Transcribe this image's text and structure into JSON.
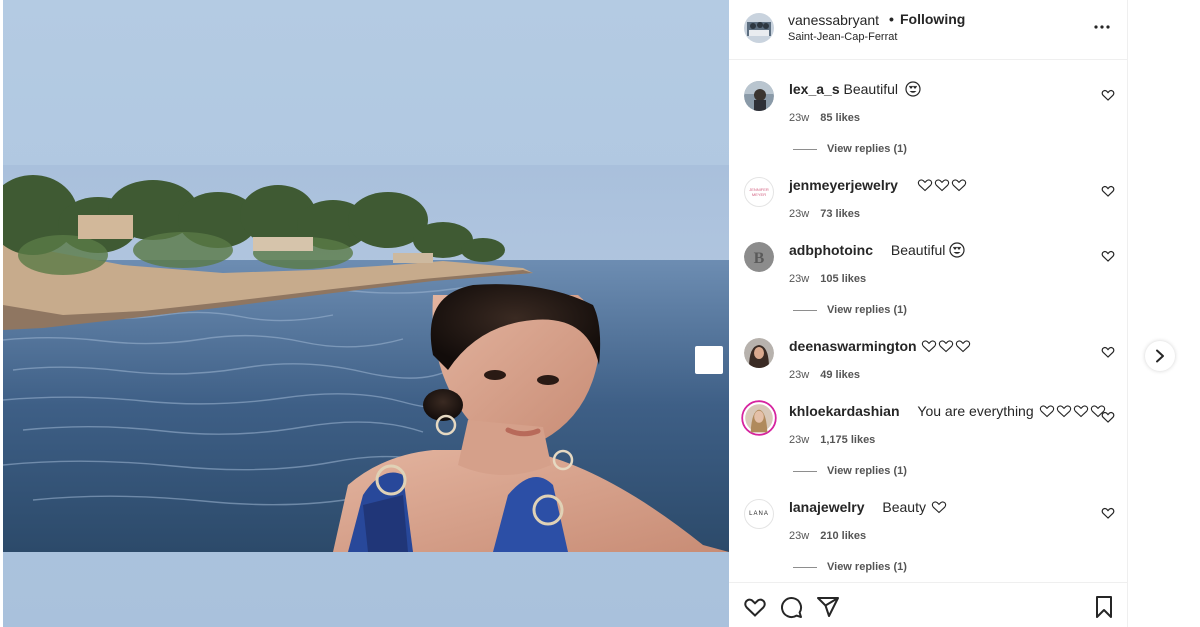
{
  "post": {
    "username": "vanessabryant",
    "follow_label": "Following",
    "location": "Saint-Jean-Cap-Ferrat"
  },
  "comments": [
    {
      "user": "lex_a_s",
      "text": "Beautiful",
      "emoji": "heart-eyes-emoji",
      "age": "23w",
      "likes": "85 likes",
      "replies": "View replies (1)"
    },
    {
      "user": "jenmeyerjewelry",
      "text": "",
      "hearts": 3,
      "age": "23w",
      "likes": "73 likes",
      "avatar_text": "JENNIFER MEYER"
    },
    {
      "user": "adbphotoinc",
      "text": "Beautiful",
      "emoji": "heart-eyes-emoji",
      "age": "23w",
      "likes": "105 likes",
      "replies": "View replies (1)"
    },
    {
      "user": "deenaswarmington",
      "text": "",
      "hearts": 3,
      "age": "23w",
      "likes": "49 likes"
    },
    {
      "user": "khloekardashian",
      "text": "You are everything",
      "hearts": 4,
      "age": "23w",
      "likes": "1,175 likes",
      "replies": "View replies (1)"
    },
    {
      "user": "lanajewelry",
      "text": "Beauty",
      "hearts": 1,
      "age": "23w",
      "likes": "210 likes",
      "replies": "View replies (1)",
      "avatar_text": "LANA"
    }
  ],
  "icons": {
    "more": "more-options-icon",
    "like": "heart-icon",
    "comment": "comment-icon",
    "share": "share-icon",
    "save": "bookmark-icon",
    "next": "chevron-right-icon"
  },
  "colors": {
    "text": "#262626",
    "muted": "#555555",
    "border": "#efefef",
    "media_bg": "#b4cbe3",
    "water": "#3a5a7a"
  }
}
